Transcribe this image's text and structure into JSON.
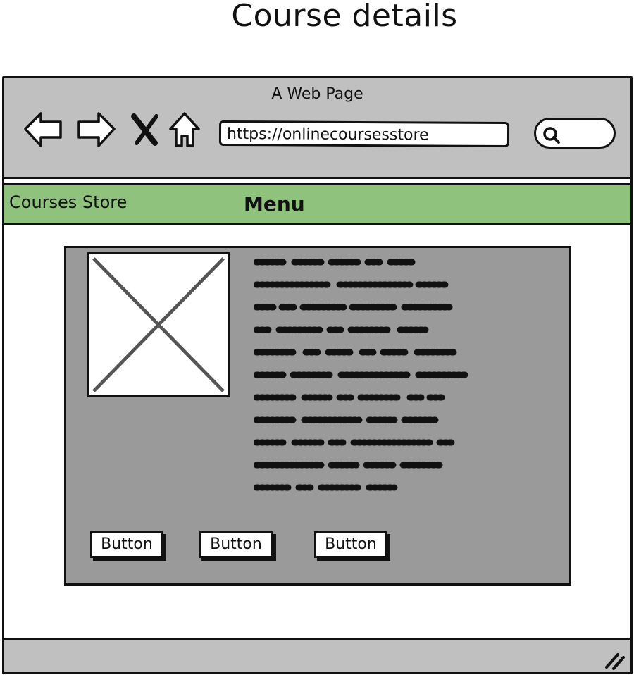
{
  "page": {
    "title": "Course details"
  },
  "browser": {
    "window_title": "A Web Page",
    "url": "https://onlinecoursesstore",
    "nav_icons": [
      "back-arrow-icon",
      "forward-arrow-icon",
      "close-x-icon",
      "home-icon"
    ],
    "search_icon": "search-icon"
  },
  "menubar": {
    "store_name": "Courses Store",
    "menu_label": "Menu",
    "color": "#8fc27c"
  },
  "content": {
    "image": "image-placeholder",
    "text": "scribbled placeholder text",
    "buttons": [
      "Button",
      "Button",
      "Button"
    ],
    "panel_color": "#9a9a9a"
  },
  "statusbar": {
    "resize_icon": "resize-grip-icon"
  }
}
